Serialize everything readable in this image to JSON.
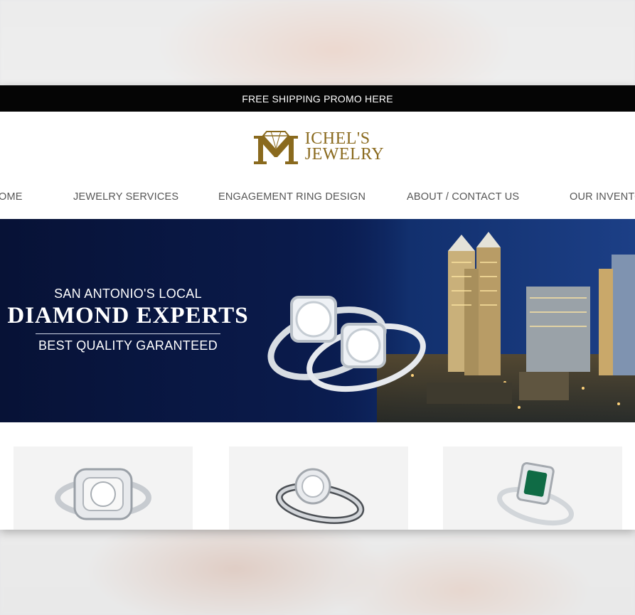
{
  "promo": {
    "text": "FREE SHIPPING PROMO HERE"
  },
  "brand": {
    "line1": "ICHEL'S",
    "line2": "JEWELRY",
    "color": "#8a6a1e"
  },
  "nav": {
    "items": [
      {
        "label": "OME"
      },
      {
        "label": "JEWELRY SERVICES"
      },
      {
        "label": "ENGAGEMENT RING DESIGN"
      },
      {
        "label": "ABOUT / CONTACT US"
      },
      {
        "label": "OUR INVENTO"
      }
    ]
  },
  "hero": {
    "kicker": "SAN ANTONIO'S LOCAL",
    "headline": "DIAMOND EXPERTS",
    "tagline": "BEST QUALITY GARANTEED",
    "background_color": "#0a1a4a"
  },
  "products": [
    {
      "icon": "halo-diamond-ring-icon"
    },
    {
      "icon": "round-halo-ring-icon"
    },
    {
      "icon": "emerald-ring-icon"
    }
  ]
}
